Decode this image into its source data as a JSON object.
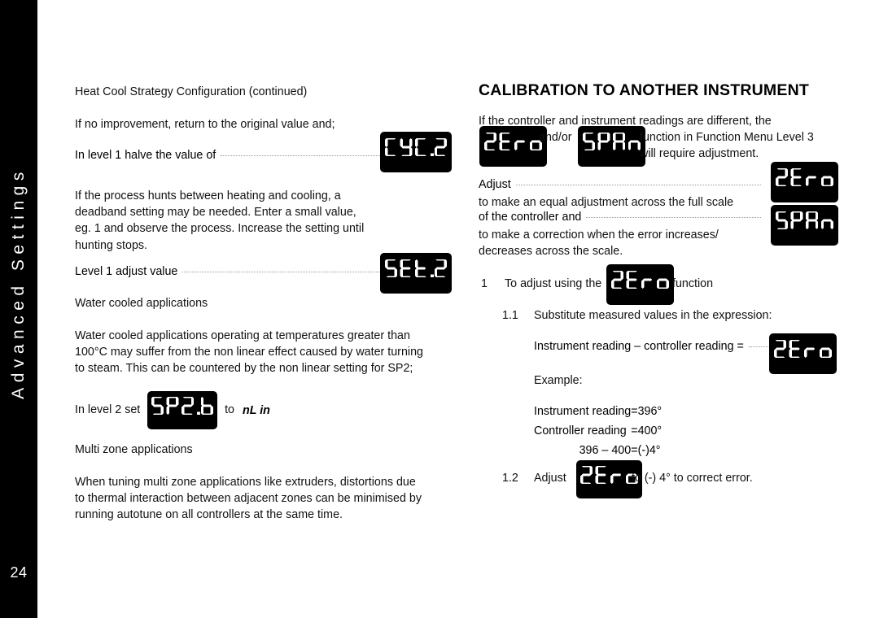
{
  "sidebar": {
    "title": "Advanced Settings",
    "page_number": "24",
    "background_color": "#000000",
    "text_color": "#ffffff"
  },
  "left_column": {
    "running_head": "Heat Cool Strategy Configuration (continued)",
    "p1": "If no improvement, return to the original value and;",
    "leader1_text": "In level 1 halve the value of",
    "leader1_badge": "CYC.2",
    "p2_lines": [
      "If the process hunts between heating and cooling, a",
      "deadband setting may be needed. Enter a small value,",
      "eg. 1  and observe the process. Increase the setting until",
      "hunting stops."
    ],
    "leader2_text": "Level 1 adjust value",
    "leader2_badge": "SEt.2",
    "heading_water": "Water cooled applications",
    "p3_lines": [
      "Water cooled applications operating at temperatures greater than",
      "100°C may suffer from the non linear effect caused by water turning",
      "to steam. This can be countered by the non linear setting for SP2;"
    ],
    "set_prefix": "In level 2 set",
    "set_badge": "SP2.b",
    "set_middle": "to",
    "set_value": "nL in",
    "heading_multizone": "Multi zone applications",
    "p4_lines": [
      "When tuning multi zone applications like extruders, distortions due",
      "to thermal interaction between adjacent zones can be minimised by",
      "running autotune on all controllers at the same time."
    ]
  },
  "right_column": {
    "heading": "CALIBRATION TO ANOTHER INSTRUMENT",
    "intro_line1": "If the controller and instrument readings are different, the",
    "badge_zero": "2Ero",
    "andor": "and/or",
    "badge_span": "SPAn",
    "intro_line2": "function in Function Menu Level 3",
    "intro_line3": "will require adjustment.",
    "adjust_label": "Adjust",
    "adjust_badge1": "2Ero",
    "adjust_line2": "to make an equal adjustment across the full scale",
    "adjust_line3": "of the controller and",
    "adjust_badge2": "SPAn",
    "adjust_line4": "to make a correction when the error increases/",
    "adjust_line5": "decreases across the scale.",
    "step1_num": "1",
    "step1_pre": "To adjust using the",
    "step1_badge": "2Ero",
    "step1_post": "function",
    "step11_num": "1.1",
    "step11_text": "Substitute measured values in the expression:",
    "expression_text": "Instrument reading – controller reading =",
    "expression_badge": "2Ero",
    "example_label": "Example:",
    "example_rows": [
      {
        "label": "Instrument reading",
        "eq": "=",
        "value": "396°",
        "align": "left"
      },
      {
        "label": "Controller reading",
        "eq": "=",
        "value": "400°",
        "align": "left"
      },
      {
        "label": "396 – 400",
        "eq": "=",
        "value": "(-)4°",
        "align": "right"
      }
    ],
    "step12_num": "1.2",
    "step12_pre": "Adjust",
    "step12_badge": "2Ero",
    "step12_post": "to (-) 4° to correct error."
  }
}
